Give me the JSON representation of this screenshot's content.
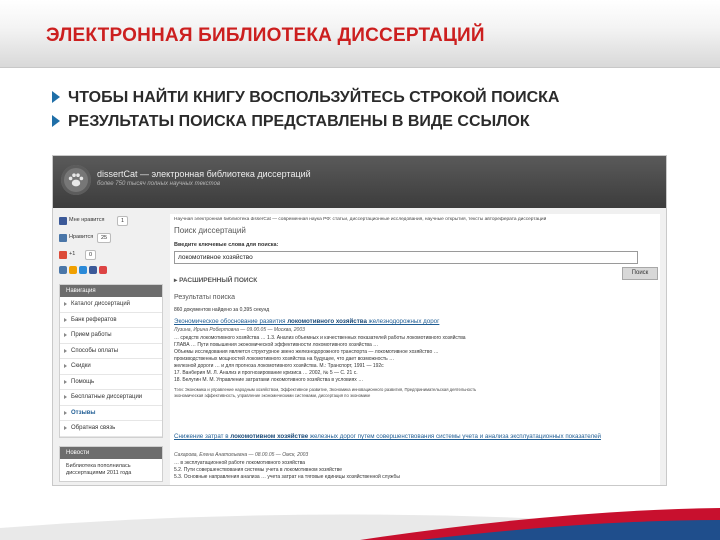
{
  "slide": {
    "title": "ЭЛЕКТРОННАЯ БИБЛИОТЕКА ДИССЕРТАЦИЙ",
    "bullets": [
      "ЧТОБЫ НАЙТИ КНИГУ ВОСПОЛЬЗУЙТЕСЬ СТРОКОЙ ПОИСКА",
      "РЕЗУЛЬТАТЫ ПОИСКА ПРЕДСТАВЛЕНЫ В ВИДЕ ССЫЛОК"
    ]
  },
  "site": {
    "name": "dissertCat — электронная библиотека диссертаций",
    "subtitle": "более 750 тысяч полных научных текстов"
  },
  "sidebar": {
    "social": [
      {
        "label": "Мне нравится",
        "count": "1",
        "color": "#3b5998"
      },
      {
        "label": "Нравится",
        "count": "25",
        "color": "#4a76a8"
      },
      {
        "label": "+1",
        "count": "0",
        "color": "#dd4b39"
      }
    ],
    "nav_title": "Навигация",
    "nav_items": [
      "Каталог диссертаций",
      "Банк рефератов",
      "Прием работы",
      "Способы оплаты",
      "Скидки",
      "Помощь",
      "Бесплатные диссертации",
      "Отзывы",
      "Обратная связь"
    ],
    "news_title": "Новости",
    "news_text": "Библиотека пополнилась диссертациями 2011 года"
  },
  "main": {
    "breadcrumb": "Научная электронная библиотека disserCat — современная наука РФ: статьи, диссертационные исследования, научные открытия, тексты автореферата диссертаций",
    "search_heading": "Поиск диссертаций",
    "search_label": "Введите ключевые слова для поиска:",
    "search_value": "локомотивное хозяйство",
    "search_button": "Поиск",
    "advanced": "РАСШИРЕННЫЙ ПОИСК",
    "results_heading": "Результаты поиска",
    "found": "860 документов найдено за 0,395 секунд",
    "result1": {
      "title_pre": "Экономическое обоснование развития ",
      "title_bold": "локомотивного хозяйства",
      "title_post": " железнодорожных дорог",
      "author": "Лузина, Ирина Робертовна — 09.00.05 — Москва, 2003",
      "lines": [
        "… средств локомотивного хозяйства … 1.3. Анализ объемных и качественных показателей работы локомотивного хозяйства",
        "ГЛАВА … Пути повышения экономической эффективности локомотивного хозяйства …",
        "Объемы исследования является структурное звено железнодорожного транспорта — локомотивное хозяйство …",
        "производственных мощностей локомотивного хозяйства на будущее, что дает возможность …",
        "железной дороги … и для прогноза локомотивного хозяйства. М.: Транспорт, 1991 — 192с",
        "17. Ванберия М. Л. Анализ и прогнозирование кризиса … 2002, № 5 — С. 21 с.",
        "18. Белугин М. М. Управление затратами локомотивного хозяйства в условиях …"
      ],
      "tags": [
        "Тэги: Экономика и управление народным хозяйством, Эффективное развитие, Экономика инновационного развития, Предпринимательская деятельность",
        "экономическая эффективность, управление экономическими системами, диссертация по экономике"
      ]
    },
    "result2": {
      "title_pre": "Снижение затрат в ",
      "title_bold": "локомотивном хозяйстве",
      "title_post": " железных дорог путем совершенствования системы учета и анализа эксплуатационных показателей",
      "author": "Сахарова, Елена Анатольевна — 08.00.05 — Омск, 2003",
      "lines": [
        "… в эксплуатационной работе локомотивного хозяйства",
        "5.2. Пути совершенствования системы учета в локомотивном хозяйстве",
        "5.3. Основные направления анализа … учета затрат на тяговые единицы хозяйственной службы"
      ]
    }
  }
}
